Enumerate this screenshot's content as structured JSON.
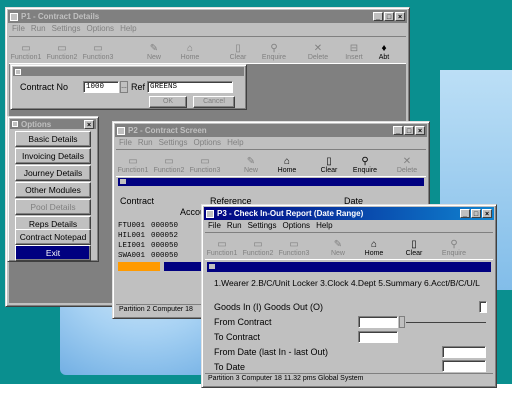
{
  "win1": {
    "title": "P1 - Contract Details",
    "menu": [
      "File",
      "Run",
      "Settings",
      "Options",
      "Help"
    ],
    "tools": [
      "Function1",
      "Function2",
      "Function3",
      "New",
      "Home",
      "Clear",
      "Enquire",
      "Delete",
      "Insert",
      "Abt"
    ],
    "dialog": {
      "contract_label": "Contract No",
      "contract_value": "1000",
      "ref_label": "Ref",
      "ref_value": "GREENS",
      "ok_label": "OK",
      "cancel_label": "Cancel"
    }
  },
  "options": {
    "title": "Options",
    "items": [
      "Basic Details",
      "Invoicing Details",
      "Journey Details",
      "Other Modules",
      "Pool Details",
      "Reps Details",
      "Contract Notepad",
      "Exit"
    ]
  },
  "win2": {
    "title": "P2 - Contract Screen",
    "menu": [
      "File",
      "Run",
      "Settings",
      "Options",
      "Help"
    ],
    "tools": [
      "Function1",
      "Function2",
      "Function3",
      "New",
      "Home",
      "Clear",
      "Enquire",
      "Delete"
    ],
    "headers": {
      "contract": "Contract",
      "reference": "Reference",
      "account": "Account",
      "date": "Date"
    },
    "rows": [
      {
        "contract": "FTU001",
        "account": "000050"
      },
      {
        "contract": "HIL001",
        "account": "000052"
      },
      {
        "contract": "LEI001",
        "account": "000050"
      },
      {
        "contract": "SWA001",
        "account": "000050"
      }
    ],
    "status": "Partition 2 Computer 18"
  },
  "win3": {
    "title": "P3 - Check In-Out Report (Date Range)",
    "menu": [
      "File",
      "Run",
      "Settings",
      "Options",
      "Help"
    ],
    "tools": [
      "Function1",
      "Function2",
      "Function3",
      "New",
      "Home",
      "Clear",
      "Enquire"
    ],
    "sort_line": "1.Wearer 2.B/C/Unit Locker 3.Clock 4.Dept 5.Summary 6.Acct/B/C/U/L",
    "goods_label": "Goods In (I)  Goods Out (O)",
    "from_contract": "From Contract",
    "to_contract": "To  Contract",
    "from_date": "From Date (last In - last Out)",
    "to_date": "To  Date",
    "status": "Partition 3 Computer 18  11.32 pms  Global System"
  }
}
